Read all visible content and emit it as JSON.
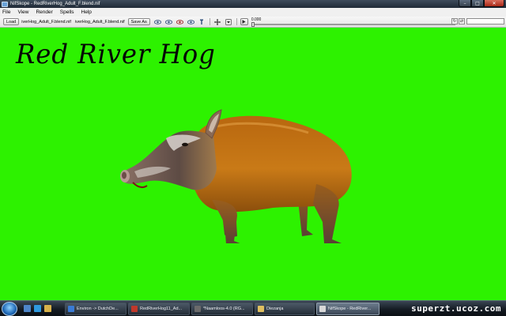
{
  "window": {
    "title": "NifSkope - RedRiverHog_Adult_F.blend.nif",
    "min_glyph": "–",
    "max_glyph": "□",
    "close_glyph": "✕"
  },
  "menu": [
    "File",
    "View",
    "Render",
    "Spells",
    "Help"
  ],
  "toolbar": {
    "load_label": "Load",
    "file_left": "iverHog_Adult_F.blend.nif",
    "file_right": "iverHog_Adult_F.blend.nif",
    "save_label": "Save As",
    "time_value": "0.000",
    "icons": [
      "eye-icon",
      "eye-icon",
      "eye-icon",
      "eye-icon",
      "bone-icon",
      "pan-icon",
      "dropdown-icon"
    ]
  },
  "viewport": {
    "background_color": "#2df200",
    "caption": "Red River Hog"
  },
  "taskbar": {
    "quick_launch": [
      "desktop-icon",
      "ie-icon",
      "folder-icon"
    ],
    "tasks": [
      {
        "label": "Environ -> DutchDe...",
        "icon_color": "#3a7bd5",
        "active": false
      },
      {
        "label": "RedRiverHog11_Ad...",
        "icon_color": "#c0392b",
        "active": false
      },
      {
        "label": "*Naamloos-4.0 (RG...",
        "icon_color": "#6b6b6b",
        "active": false
      },
      {
        "label": "Diezanja",
        "icon_color": "#e0c060",
        "active": false
      },
      {
        "label": "NifSkope - RedRiver...",
        "icon_color": "#d8d8d8",
        "active": true
      }
    ],
    "watermark": "superzt.ucoz.com"
  }
}
